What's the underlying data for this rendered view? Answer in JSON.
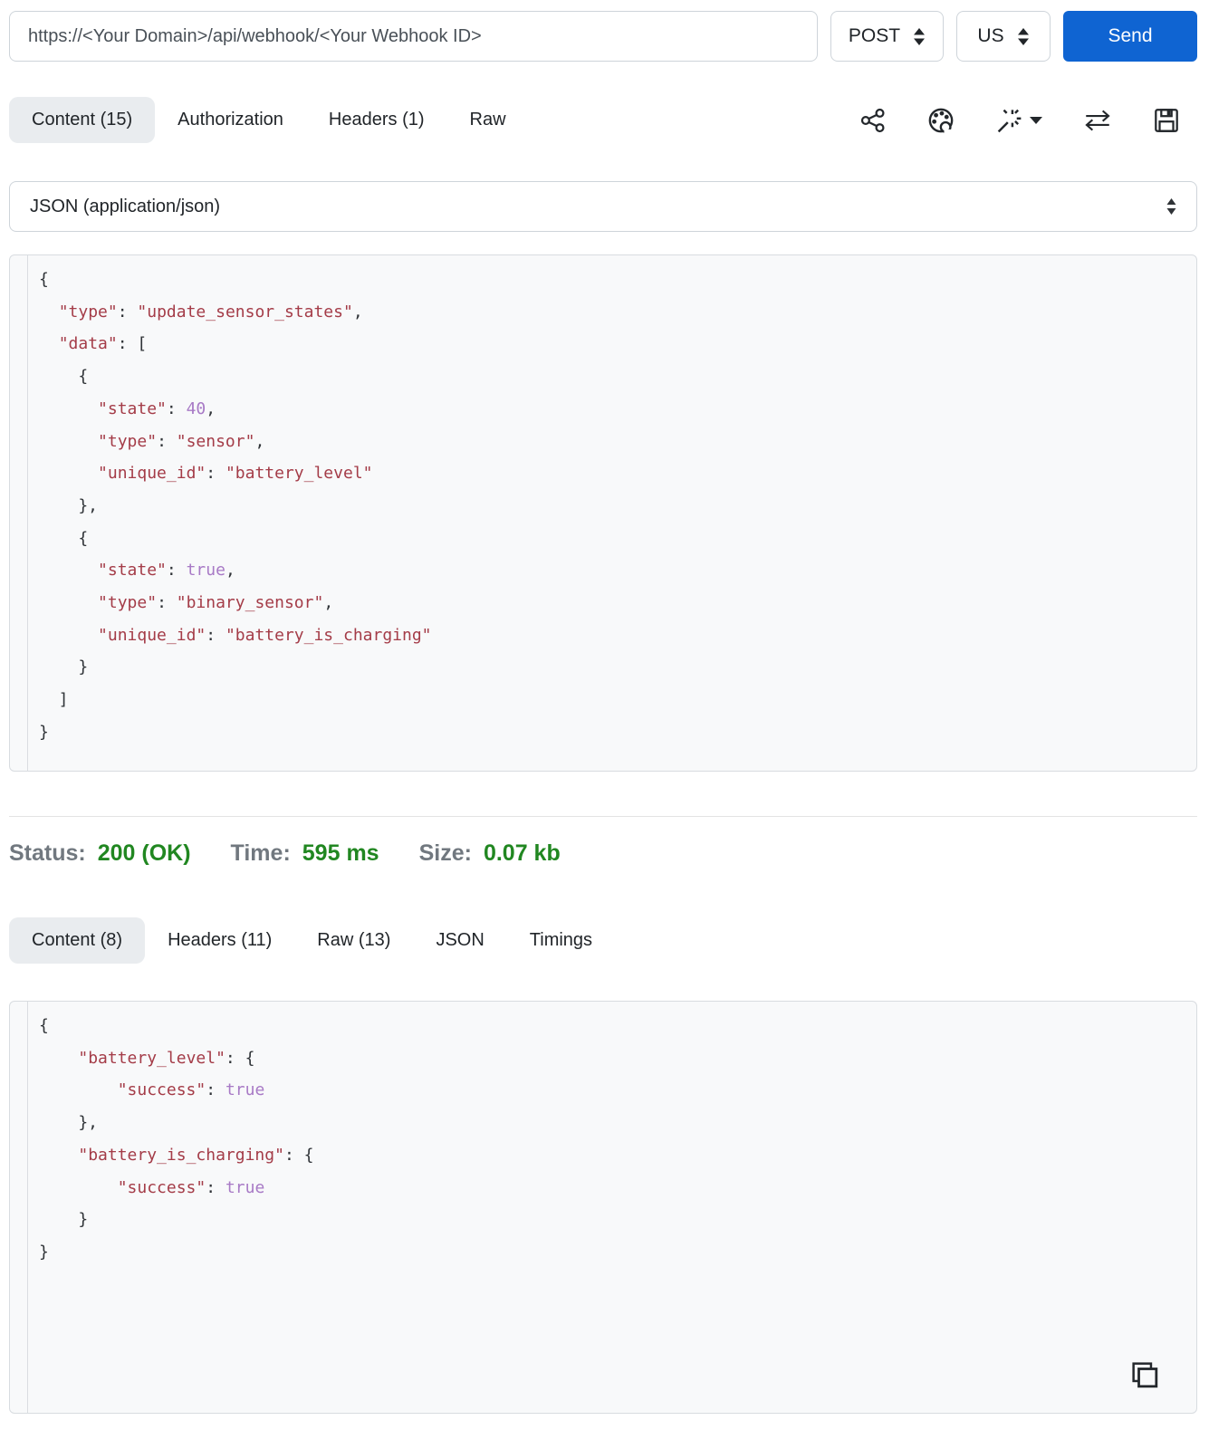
{
  "colors": {
    "accent_blue": "#0f64d2",
    "success_green": "#218721",
    "string_red": "#a43c48",
    "literal_purple": "#a87ac6",
    "active_tab_bg": "#e9ecef",
    "code_bg": "#f8f9fa"
  },
  "request": {
    "url": "https://<Your Domain>/api/webhook/<Your Webhook ID>",
    "method": "POST",
    "region": "US",
    "send_label": "Send",
    "tabs": [
      {
        "label": "Content (15)"
      },
      {
        "label": "Authorization"
      },
      {
        "label": "Headers (1)"
      },
      {
        "label": "Raw"
      }
    ],
    "toolbar_icons": [
      "share-icon",
      "palette-icon",
      "magic-wand-icon",
      "swap-icon",
      "save-icon"
    ],
    "content_type": "JSON (application/json)",
    "body_lines": [
      [
        {
          "c": "p",
          "t": "{"
        }
      ],
      [
        {
          "c": "p",
          "t": "  "
        },
        {
          "c": "s",
          "t": "\"type\""
        },
        {
          "c": "p",
          "t": ": "
        },
        {
          "c": "s",
          "t": "\"update_sensor_states\""
        },
        {
          "c": "p",
          "t": ","
        }
      ],
      [
        {
          "c": "p",
          "t": "  "
        },
        {
          "c": "s",
          "t": "\"data\""
        },
        {
          "c": "p",
          "t": ": ["
        }
      ],
      [
        {
          "c": "p",
          "t": "    {"
        }
      ],
      [
        {
          "c": "p",
          "t": "      "
        },
        {
          "c": "s",
          "t": "\"state\""
        },
        {
          "c": "p",
          "t": ": "
        },
        {
          "c": "n",
          "t": "40"
        },
        {
          "c": "p",
          "t": ","
        }
      ],
      [
        {
          "c": "p",
          "t": "      "
        },
        {
          "c": "s",
          "t": "\"type\""
        },
        {
          "c": "p",
          "t": ": "
        },
        {
          "c": "s",
          "t": "\"sensor\""
        },
        {
          "c": "p",
          "t": ","
        }
      ],
      [
        {
          "c": "p",
          "t": "      "
        },
        {
          "c": "s",
          "t": "\"unique_id\""
        },
        {
          "c": "p",
          "t": ": "
        },
        {
          "c": "s",
          "t": "\"battery_level\""
        }
      ],
      [
        {
          "c": "p",
          "t": "    },"
        }
      ],
      [
        {
          "c": "p",
          "t": "    {"
        }
      ],
      [
        {
          "c": "p",
          "t": "      "
        },
        {
          "c": "s",
          "t": "\"state\""
        },
        {
          "c": "p",
          "t": ": "
        },
        {
          "c": "n",
          "t": "true"
        },
        {
          "c": "p",
          "t": ","
        }
      ],
      [
        {
          "c": "p",
          "t": "      "
        },
        {
          "c": "s",
          "t": "\"type\""
        },
        {
          "c": "p",
          "t": ": "
        },
        {
          "c": "s",
          "t": "\"binary_sensor\""
        },
        {
          "c": "p",
          "t": ","
        }
      ],
      [
        {
          "c": "p",
          "t": "      "
        },
        {
          "c": "s",
          "t": "\"unique_id\""
        },
        {
          "c": "p",
          "t": ": "
        },
        {
          "c": "s",
          "t": "\"battery_is_charging\""
        }
      ],
      [
        {
          "c": "p",
          "t": "    }"
        }
      ],
      [
        {
          "c": "p",
          "t": "  ]"
        }
      ],
      [
        {
          "c": "p",
          "t": "}"
        }
      ]
    ]
  },
  "status": {
    "status_label": "Status:",
    "status_value": "200 (OK)",
    "time_label": "Time:",
    "time_value": "595 ms",
    "size_label": "Size:",
    "size_value": "0.07 kb"
  },
  "response": {
    "tabs": [
      {
        "label": "Content (8)"
      },
      {
        "label": "Headers (11)"
      },
      {
        "label": "Raw (13)"
      },
      {
        "label": "JSON"
      },
      {
        "label": "Timings"
      }
    ],
    "body_lines": [
      [
        {
          "c": "p",
          "t": "{"
        }
      ],
      [
        {
          "c": "p",
          "t": "    "
        },
        {
          "c": "s",
          "t": "\"battery_level\""
        },
        {
          "c": "p",
          "t": ": {"
        }
      ],
      [
        {
          "c": "p",
          "t": "        "
        },
        {
          "c": "s",
          "t": "\"success\""
        },
        {
          "c": "p",
          "t": ": "
        },
        {
          "c": "n",
          "t": "true"
        }
      ],
      [
        {
          "c": "p",
          "t": "    },"
        }
      ],
      [
        {
          "c": "p",
          "t": "    "
        },
        {
          "c": "s",
          "t": "\"battery_is_charging\""
        },
        {
          "c": "p",
          "t": ": {"
        }
      ],
      [
        {
          "c": "p",
          "t": "        "
        },
        {
          "c": "s",
          "t": "\"success\""
        },
        {
          "c": "p",
          "t": ": "
        },
        {
          "c": "n",
          "t": "true"
        }
      ],
      [
        {
          "c": "p",
          "t": "    }"
        }
      ],
      [
        {
          "c": "p",
          "t": "}"
        }
      ]
    ]
  }
}
